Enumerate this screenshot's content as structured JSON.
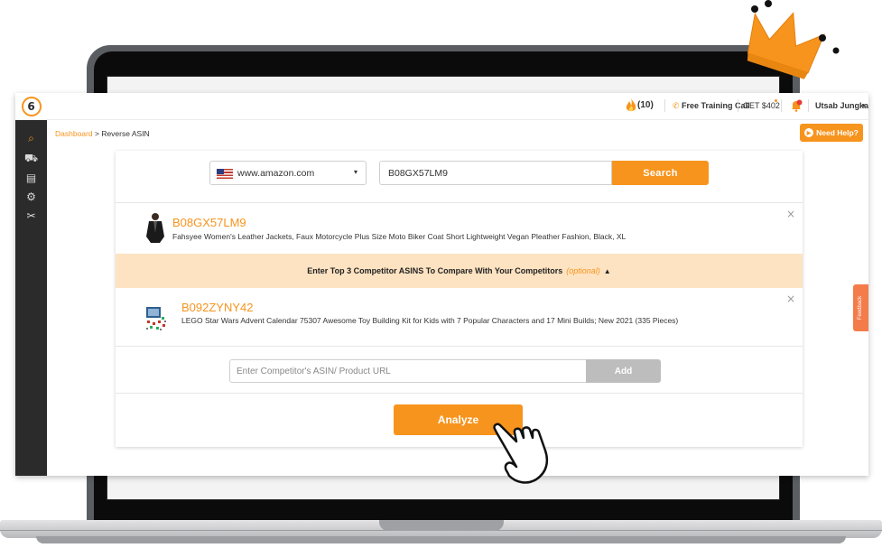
{
  "colors": {
    "accent": "#f7941d",
    "sidebar": "#2b2b2b",
    "banner": "#fde3c2"
  },
  "topbar": {
    "fire_icon": "fire-icon",
    "credits": "(10)",
    "phone_icon": "phone-icon",
    "training_call": "Free Training Call",
    "get_offer": "GET $402",
    "bell_icon": "bell-icon",
    "user_name": "Utsab Jungkarki",
    "user_caret": "▾"
  },
  "sidebar": {
    "logo_icon": "logo-icon",
    "items": [
      {
        "icon": "reverse-search-icon",
        "glyph": "⌕",
        "active": true
      },
      {
        "icon": "cart-icon",
        "glyph": "⛟"
      },
      {
        "icon": "clipboard-icon",
        "glyph": "▤"
      },
      {
        "icon": "gear-icon",
        "glyph": "⚙"
      },
      {
        "icon": "tools-icon",
        "glyph": "✂"
      }
    ]
  },
  "breadcrumb": {
    "root": "Dashboard",
    "separator": ">",
    "current": "Reverse ASIN"
  },
  "help_button": {
    "label": "Need Help?"
  },
  "search": {
    "marketplace": "www.amazon.com",
    "caret": "▾",
    "asin_value": "B08GX57LM9",
    "button": "Search"
  },
  "main_product": {
    "asin": "B08GX57LM9",
    "title": "Fahsyee Women's Leather Jackets, Faux Motorcycle Plus Size Moto Biker Coat Short Lightweight Vegan Pleather Fashion, Black, XL",
    "close": "×"
  },
  "compare_banner": {
    "text": "Enter Top 3 Competitor ASINS To Compare With Your Competitors",
    "optional": "(optional)",
    "arrow": "▲"
  },
  "competitor": {
    "asin": "B092ZYNY42",
    "title": "LEGO Star Wars Advent Calendar 75307 Awesome Toy Building Kit for Kids with 7 Popular Characters and 17 Mini Builds; New 2021 (335 Pieces)",
    "close": "×"
  },
  "competitor_input": {
    "placeholder": "Enter Competitor's ASIN/ Product URL",
    "button": "Add"
  },
  "analyze_button": "Analyze",
  "feedback_tab": "Feedback"
}
